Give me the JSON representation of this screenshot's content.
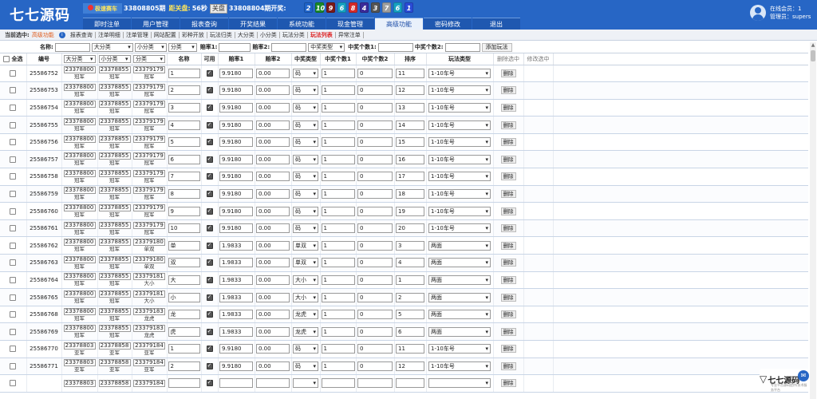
{
  "header": {
    "logo": "七七源码",
    "lottery_name": "极速赛车",
    "current_issue": "33808805期",
    "countdown_label": "距关盘:",
    "countdown": "56秒",
    "close_button": "关盘",
    "last_issue": "33808804期开奖:",
    "balls": [
      {
        "num": "2",
        "color": "#1e63c9"
      },
      {
        "num": "10",
        "color": "#1a8a2a"
      },
      {
        "num": "9",
        "color": "#7a1a1a"
      },
      {
        "num": "6",
        "color": "#17a2c2"
      },
      {
        "num": "8",
        "color": "#d42a2a"
      },
      {
        "num": "4",
        "color": "#3b2b9a"
      },
      {
        "num": "3",
        "color": "#555555"
      },
      {
        "num": "7",
        "color": "#9e9e9e"
      },
      {
        "num": "6",
        "color": "#17a2c2"
      },
      {
        "num": "1",
        "color": "#2a4bd6"
      }
    ]
  },
  "nav": {
    "items": [
      "即时注单",
      "用户管理",
      "报表查询",
      "开奖结果",
      "系统功能",
      "现金管理",
      "高级功能",
      "密码修改",
      "退出"
    ],
    "active_index": 6
  },
  "user": {
    "online_label": "在线会员：1",
    "admin_label": "管理员：supers"
  },
  "subnav": {
    "current_label": "当前选中:",
    "current_value": "高级功能",
    "links": [
      "报表查询",
      "注单明细",
      "注单管理",
      "网站配置",
      "彩种开放",
      "玩法归类",
      "大分类",
      "小分类",
      "玩法分类",
      "玩法列表",
      "异常注单"
    ],
    "active_link": "玩法列表"
  },
  "filter": {
    "name_label": "名称:",
    "big_class": "大分类",
    "small_class": "小分类",
    "category": "分类",
    "odds1_label": "赔率1:",
    "odds2_label": "赔率2:",
    "prize_type": "中奖类型",
    "prize_count1_label": "中奖个数1:",
    "prize_count2_label": "中奖个数2:",
    "add_button": "添加玩法"
  },
  "table": {
    "headers": {
      "select_all": "全选",
      "id": "编号",
      "big_class": "大分类",
      "small_class": "小分类",
      "category": "分类",
      "name": "名称",
      "enabled": "可用",
      "odds1": "赔率1",
      "odds2": "赔率2",
      "prize_type": "中奖类型",
      "prize_count1": "中奖个数1",
      "prize_count2": "中奖个数2",
      "sort": "排序",
      "play_type": "玩法类型",
      "delete_selected": "删除选中",
      "edit_selected": "修改选中"
    },
    "delete_label": "删除",
    "rows": [
      {
        "id": "25586752",
        "big": "23378800",
        "big_lbl": "冠军",
        "small": "23378855",
        "small_lbl": "冠军",
        "cat": "23379179",
        "cat_lbl": "冠军",
        "name": "1",
        "odds1": "9.9180",
        "odds2": "0.00",
        "ptype": "码",
        "p1": "1",
        "p2": "0",
        "sort": "11",
        "play": "1-10车号"
      },
      {
        "id": "25586753",
        "big": "23378800",
        "big_lbl": "冠军",
        "small": "23378855",
        "small_lbl": "冠军",
        "cat": "23379179",
        "cat_lbl": "冠军",
        "name": "2",
        "odds1": "9.9180",
        "odds2": "0.00",
        "ptype": "码",
        "p1": "1",
        "p2": "0",
        "sort": "12",
        "play": "1-10车号"
      },
      {
        "id": "25586754",
        "big": "23378800",
        "big_lbl": "冠军",
        "small": "23378855",
        "small_lbl": "冠军",
        "cat": "23379179",
        "cat_lbl": "冠军",
        "name": "3",
        "odds1": "9.9180",
        "odds2": "0.00",
        "ptype": "码",
        "p1": "1",
        "p2": "0",
        "sort": "13",
        "play": "1-10车号"
      },
      {
        "id": "25586755",
        "big": "23378800",
        "big_lbl": "冠军",
        "small": "23378855",
        "small_lbl": "冠军",
        "cat": "23379179",
        "cat_lbl": "冠军",
        "name": "4",
        "odds1": "9.9180",
        "odds2": "0.00",
        "ptype": "码",
        "p1": "1",
        "p2": "0",
        "sort": "14",
        "play": "1-10车号"
      },
      {
        "id": "25586756",
        "big": "23378800",
        "big_lbl": "冠军",
        "small": "23378855",
        "small_lbl": "冠军",
        "cat": "23379179",
        "cat_lbl": "冠军",
        "name": "5",
        "odds1": "9.9180",
        "odds2": "0.00",
        "ptype": "码",
        "p1": "1",
        "p2": "0",
        "sort": "15",
        "play": "1-10车号"
      },
      {
        "id": "25586757",
        "big": "23378800",
        "big_lbl": "冠军",
        "small": "23378855",
        "small_lbl": "冠军",
        "cat": "23379179",
        "cat_lbl": "冠军",
        "name": "6",
        "odds1": "9.9180",
        "odds2": "0.00",
        "ptype": "码",
        "p1": "1",
        "p2": "0",
        "sort": "16",
        "play": "1-10车号"
      },
      {
        "id": "25586758",
        "big": "23378800",
        "big_lbl": "冠军",
        "small": "23378855",
        "small_lbl": "冠军",
        "cat": "23379179",
        "cat_lbl": "冠军",
        "name": "7",
        "odds1": "9.9180",
        "odds2": "0.00",
        "ptype": "码",
        "p1": "1",
        "p2": "0",
        "sort": "17",
        "play": "1-10车号"
      },
      {
        "id": "25586759",
        "big": "23378800",
        "big_lbl": "冠军",
        "small": "23378855",
        "small_lbl": "冠军",
        "cat": "23379179",
        "cat_lbl": "冠军",
        "name": "8",
        "odds1": "9.9180",
        "odds2": "0.00",
        "ptype": "码",
        "p1": "1",
        "p2": "0",
        "sort": "18",
        "play": "1-10车号"
      },
      {
        "id": "25586760",
        "big": "23378800",
        "big_lbl": "冠军",
        "small": "23378855",
        "small_lbl": "冠军",
        "cat": "23379179",
        "cat_lbl": "冠军",
        "name": "9",
        "odds1": "9.9180",
        "odds2": "0.00",
        "ptype": "码",
        "p1": "1",
        "p2": "0",
        "sort": "19",
        "play": "1-10车号"
      },
      {
        "id": "25586761",
        "big": "23378800",
        "big_lbl": "冠军",
        "small": "23378855",
        "small_lbl": "冠军",
        "cat": "23379179",
        "cat_lbl": "冠军",
        "name": "10",
        "odds1": "9.9180",
        "odds2": "0.00",
        "ptype": "码",
        "p1": "1",
        "p2": "0",
        "sort": "20",
        "play": "1-10车号"
      },
      {
        "id": "25586762",
        "big": "23378800",
        "big_lbl": "冠军",
        "small": "23378855",
        "small_lbl": "冠军",
        "cat": "23379180",
        "cat_lbl": "单双",
        "name": "单",
        "odds1": "1.9833",
        "odds2": "0.00",
        "ptype": "单双",
        "p1": "1",
        "p2": "0",
        "sort": "3",
        "play": "两面"
      },
      {
        "id": "25586763",
        "big": "23378800",
        "big_lbl": "冠军",
        "small": "23378855",
        "small_lbl": "冠军",
        "cat": "23379180",
        "cat_lbl": "单双",
        "name": "双",
        "odds1": "1.9833",
        "odds2": "0.00",
        "ptype": "单双",
        "p1": "1",
        "p2": "0",
        "sort": "4",
        "play": "两面"
      },
      {
        "id": "25586764",
        "big": "23378800",
        "big_lbl": "冠军",
        "small": "23378855",
        "small_lbl": "冠军",
        "cat": "23379181",
        "cat_lbl": "大小",
        "name": "大",
        "odds1": "1.9833",
        "odds2": "0.00",
        "ptype": "大小",
        "p1": "1",
        "p2": "0",
        "sort": "1",
        "play": "两面"
      },
      {
        "id": "25586765",
        "big": "23378800",
        "big_lbl": "冠军",
        "small": "23378855",
        "small_lbl": "冠军",
        "cat": "23379181",
        "cat_lbl": "大小",
        "name": "小",
        "odds1": "1.9833",
        "odds2": "0.00",
        "ptype": "大小",
        "p1": "1",
        "p2": "0",
        "sort": "2",
        "play": "两面"
      },
      {
        "id": "25586768",
        "big": "23378800",
        "big_lbl": "冠军",
        "small": "23378855",
        "small_lbl": "冠军",
        "cat": "23379183",
        "cat_lbl": "龙虎",
        "name": "龙",
        "odds1": "1.9833",
        "odds2": "0.00",
        "ptype": "龙虎",
        "p1": "1",
        "p2": "0",
        "sort": "5",
        "play": "两面"
      },
      {
        "id": "25586769",
        "big": "23378800",
        "big_lbl": "冠军",
        "small": "23378855",
        "small_lbl": "冠军",
        "cat": "23379183",
        "cat_lbl": "龙虎",
        "name": "虎",
        "odds1": "1.9833",
        "odds2": "0.00",
        "ptype": "龙虎",
        "p1": "1",
        "p2": "0",
        "sort": "6",
        "play": "两面"
      },
      {
        "id": "25586770",
        "big": "23378803",
        "big_lbl": "亚军",
        "small": "23378858",
        "small_lbl": "亚军",
        "cat": "23379184",
        "cat_lbl": "亚军",
        "name": "1",
        "odds1": "9.9180",
        "odds2": "0.00",
        "ptype": "码",
        "p1": "1",
        "p2": "0",
        "sort": "11",
        "play": "1-10车号"
      },
      {
        "id": "25586771",
        "big": "23378803",
        "big_lbl": "亚军",
        "small": "23378858",
        "small_lbl": "亚军",
        "cat": "23379184",
        "cat_lbl": "亚军",
        "name": "2",
        "odds1": "9.9180",
        "odds2": "0.00",
        "ptype": "码",
        "p1": "1",
        "p2": "0",
        "sort": "12",
        "play": "1-10车号"
      },
      {
        "id": "",
        "big": "23378803",
        "big_lbl": "",
        "small": "23378858",
        "small_lbl": "",
        "cat": "23379184",
        "cat_lbl": "",
        "name": "",
        "odds1": "",
        "odds2": "",
        "ptype": "",
        "p1": "",
        "p2": "",
        "sort": "",
        "play": ""
      }
    ]
  },
  "float_logo": {
    "text": "七七源码",
    "sub": "专业平台源码提供/技术服务平台"
  }
}
